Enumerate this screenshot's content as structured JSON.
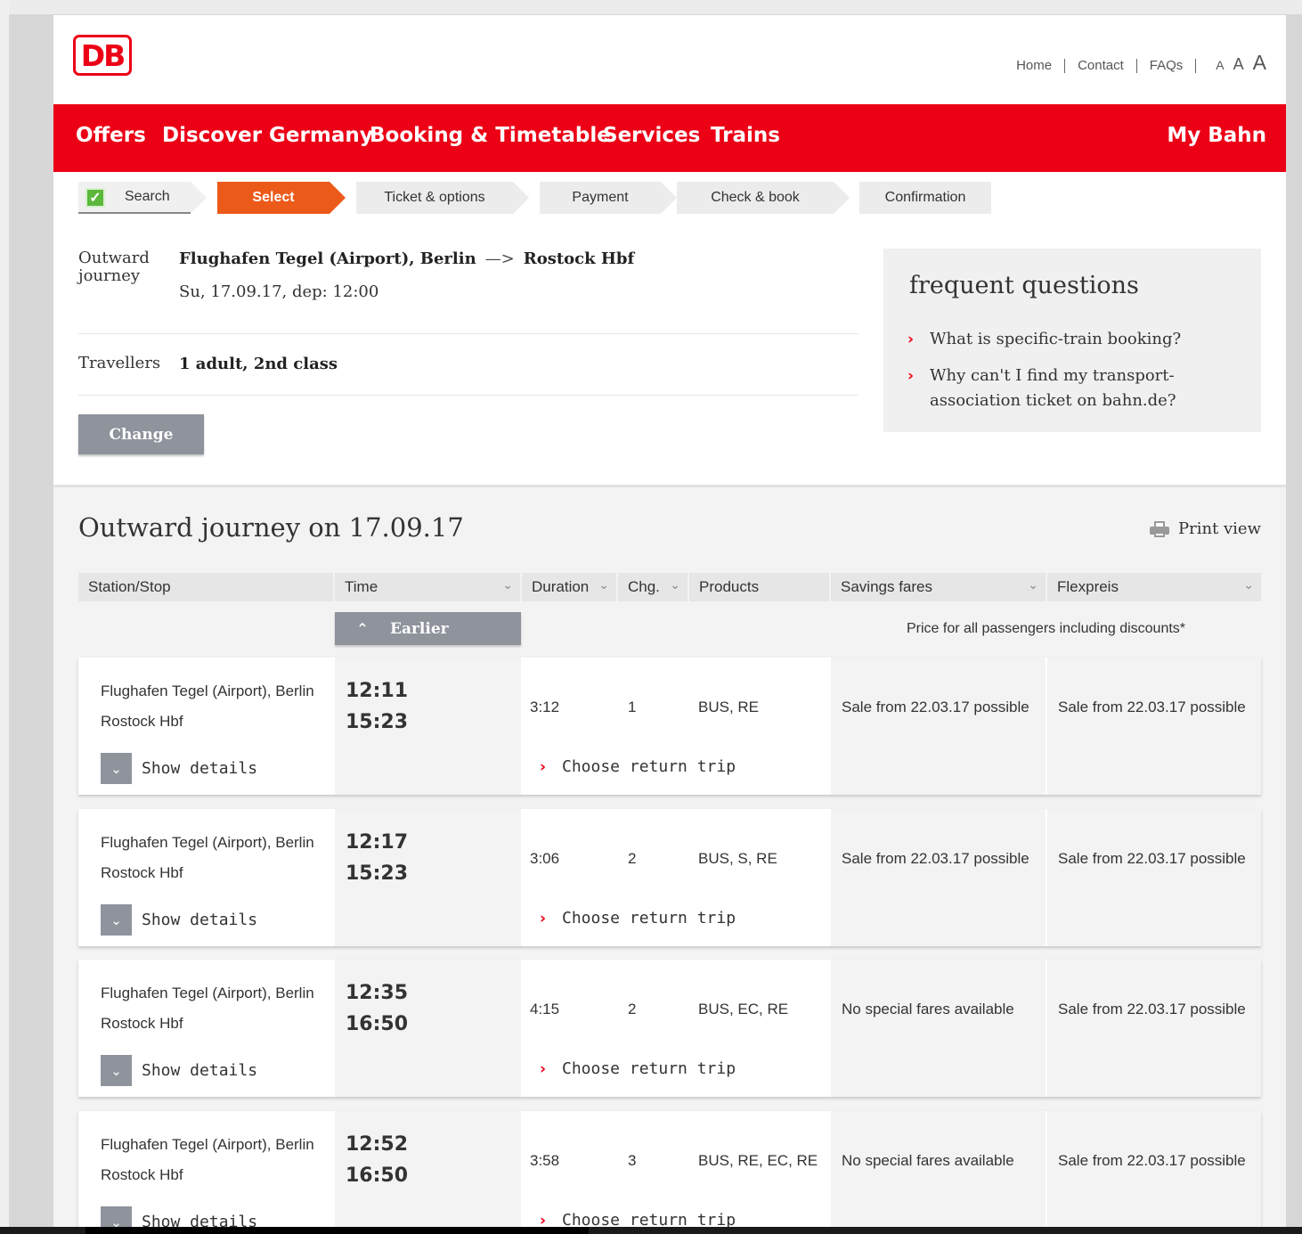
{
  "brand": {
    "logo_text": "DB",
    "color": "#ec0016"
  },
  "meta_nav": [
    "Home",
    "Contact",
    "FAQs"
  ],
  "font_size_controls": [
    "A",
    "A",
    "A"
  ],
  "main_nav": {
    "items": [
      "Offers",
      "Discover Germany",
      "Booking & Timetable",
      "Services",
      "Trains"
    ],
    "account": "My Bahn"
  },
  "steps": [
    "Search",
    "Select",
    "Ticket & options",
    "Payment",
    "Check & book",
    "Confirmation"
  ],
  "summary": {
    "outward_label_1": "Outward",
    "outward_label_2": "journey",
    "from": "Flughafen Tegel (Airport), Berlin",
    "arrow": "—>",
    "to": "Rostock Hbf",
    "date": "Su, 17.09.17, dep: 12:00",
    "travellers_label": "Travellers",
    "travellers": "1 adult, 2nd class",
    "change_button": "Change"
  },
  "faq": {
    "title": "frequent questions",
    "items": [
      "What is specific-train booking?",
      "Why can't I find my transport-association ticket on bahn.de?"
    ]
  },
  "results": {
    "title": "Outward journey on 17.09.17",
    "print": "Print view",
    "columns": [
      "Station/Stop",
      "Time",
      "Duration",
      "Chg.",
      "Products",
      "Savings fares",
      "Flexpreis"
    ],
    "earlier": "Earlier",
    "price_note": "Price for all passengers including discounts*",
    "show_details": "Show details",
    "choose_return": "Choose return trip",
    "connections": [
      {
        "from": "Flughafen Tegel (Airport), Berlin",
        "to": "Rostock Hbf",
        "dep": "12:11",
        "arr": "15:23",
        "duration": "3:12",
        "changes": "1",
        "products": "BUS, RE",
        "savings": "Sale from 22.03.17 possible",
        "flex": "Sale from 22.03.17 possible"
      },
      {
        "from": "Flughafen Tegel (Airport), Berlin",
        "to": "Rostock Hbf",
        "dep": "12:17",
        "arr": "15:23",
        "duration": "3:06",
        "changes": "2",
        "products": "BUS, S, RE",
        "savings": "Sale from 22.03.17 possible",
        "flex": "Sale from 22.03.17 possible"
      },
      {
        "from": "Flughafen Tegel (Airport), Berlin",
        "to": "Rostock Hbf",
        "dep": "12:35",
        "arr": "16:50",
        "duration": "4:15",
        "changes": "2",
        "products": "BUS, EC, RE",
        "savings": "No special fares available",
        "flex": "Sale from 22.03.17 possible"
      },
      {
        "from": "Flughafen Tegel (Airport), Berlin",
        "to": "Rostock Hbf",
        "dep": "12:52",
        "arr": "16:50",
        "duration": "3:58",
        "changes": "3",
        "products": "BUS, RE, EC, RE",
        "savings": "No special fares available",
        "flex": "Sale from 22.03.17 possible"
      }
    ]
  }
}
